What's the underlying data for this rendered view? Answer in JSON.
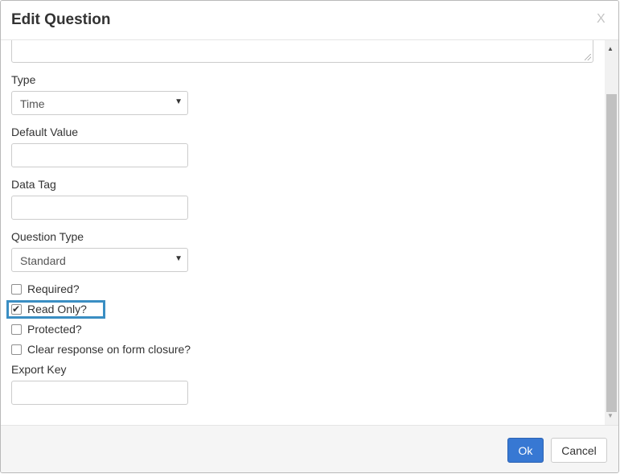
{
  "dialog": {
    "title": "Edit Question",
    "close_label": "X"
  },
  "form": {
    "type_label": "Type",
    "type_value": "Time",
    "default_value_label": "Default Value",
    "default_value": "",
    "data_tag_label": "Data Tag",
    "data_tag_value": "",
    "question_type_label": "Question Type",
    "question_type_value": "Standard",
    "checkboxes": [
      {
        "label": "Required?",
        "checked": false
      },
      {
        "label": "Read Only?",
        "checked": true
      },
      {
        "label": "Protected?",
        "checked": false
      },
      {
        "label": "Clear response on form closure?",
        "checked": false
      }
    ],
    "export_key_label": "Export Key",
    "export_key_value": ""
  },
  "footer": {
    "ok_label": "Ok",
    "cancel_label": "Cancel"
  },
  "colors": {
    "primary_button": "#3778d3",
    "highlight": "#3a8ec3"
  },
  "icons": {
    "close": "close-icon",
    "caret": "chevron-down-icon",
    "check": "checkmark-icon"
  }
}
